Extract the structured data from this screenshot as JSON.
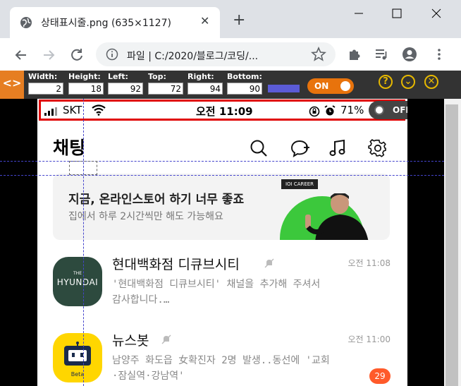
{
  "browser": {
    "tab_title": "상태표시줄.png (635×1127)",
    "url": "파일  |  C:/2020/블로그/코딩/...",
    "new_tab": "+",
    "close": "✕"
  },
  "extension": {
    "logo": "<>",
    "fields": [
      {
        "label": "Width:",
        "value": "2"
      },
      {
        "label": "Height:",
        "value": "18"
      },
      {
        "label": "Left:",
        "value": "92"
      },
      {
        "label": "Top:",
        "value": "72"
      },
      {
        "label": "Right:",
        "value": "94"
      },
      {
        "label": "Bottom:",
        "value": "90"
      }
    ],
    "swatch_color": "#5b5bd6",
    "toggle_on_label": "ON",
    "toggle_off_label": "OFF",
    "help": "?",
    "collapse": "⌄",
    "close": "✕"
  },
  "statusbar": {
    "carrier": "SKT",
    "time": "오전 11:09",
    "battery": "71%"
  },
  "app": {
    "title": "채팅"
  },
  "banner": {
    "title": "지금, 온라인스토어 하기 너무 좋죠",
    "subtitle": "집에서 하루 2시간씩만 해도 가능해요",
    "tag": "IOI CAREER"
  },
  "chats": [
    {
      "name": "현대백화점 디큐브시티",
      "message": "'현대백화점 디큐브시티' 채널을 추가해 주셔서 감사합니다.…",
      "time": "오전 11:08",
      "avatar_text_small": "THE",
      "avatar_text": "HYUNDAI",
      "badge": ""
    },
    {
      "name": "뉴스봇",
      "message": "남양주 화도읍 女확진자 2명 발생..동선에 '교회·잠실역·강남역'",
      "time": "오전 11:00",
      "avatar_text": "Beta",
      "badge": "29"
    }
  ]
}
